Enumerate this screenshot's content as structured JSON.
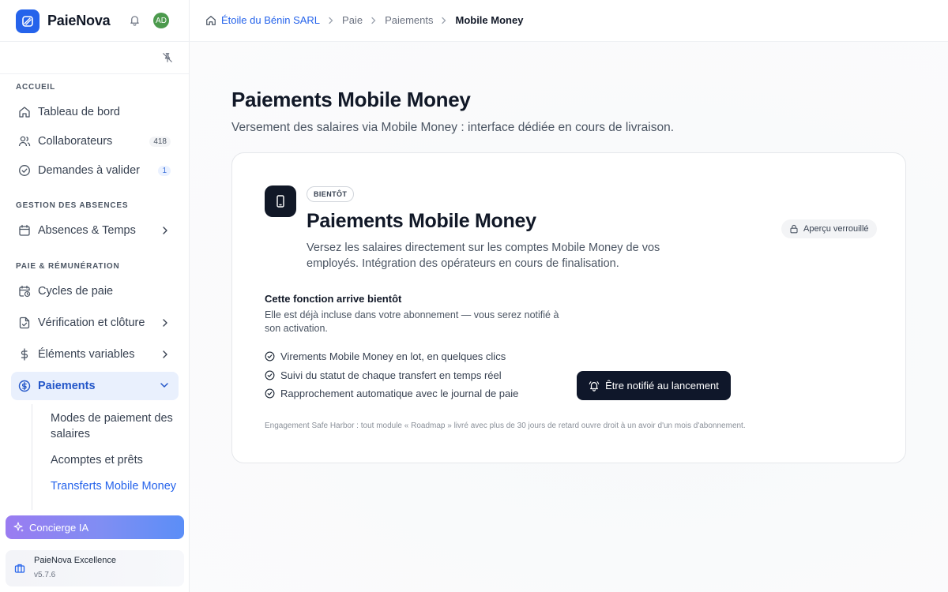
{
  "app": {
    "name": "PaieNova",
    "avatar_initials": "AD",
    "accent": "#2563eb"
  },
  "breadcrumb": [
    "Étoile du Bénin SARL",
    "Paie",
    "Paiements",
    "Mobile Money"
  ],
  "sidebar": {
    "sections": {
      "accueil": "ACCUEIL",
      "absences": "GESTION DES ABSENCES",
      "paie": "PAIE & RÉMUNÉRATION"
    },
    "items": {
      "dashboard": {
        "label": "Tableau de bord",
        "icon": "home-icon"
      },
      "collaborateurs": {
        "label": "Collaborateurs",
        "badge": "418",
        "icon": "users-icon"
      },
      "demandes": {
        "label": "Demandes à valider",
        "badge": "1",
        "icon": "check-circle-icon"
      },
      "absences": {
        "label": "Absences & Temps",
        "icon": "calendar-icon"
      },
      "cycles": {
        "label": "Cycles de paie",
        "icon": "calendar-clock-icon"
      },
      "verification": {
        "label": "Vérification et clôture",
        "icon": "file-check-icon"
      },
      "elements": {
        "label": "Éléments variables",
        "icon": "dollar-icon"
      },
      "paiements": {
        "label": "Paiements",
        "icon": "circle-dollar-icon"
      }
    },
    "sub_items": {
      "modes_line1": "Modes de paiement des",
      "modes_line2": "salaires",
      "acomptes": "Acomptes et prêts",
      "transferts": "Transferts Mobile Money"
    },
    "concierge": "Concierge IA",
    "plan": {
      "name": "PaieNova Excellence",
      "version": "v5.7.6"
    }
  },
  "page": {
    "title": "Paiements Mobile Money",
    "subtitle": "Versement des salaires via Mobile Money : interface dédiée en cours de livraison."
  },
  "card": {
    "badge": "BIENTÔT",
    "title": "Paiements Mobile Money",
    "description": "Versez les salaires directement sur les comptes Mobile Money de vos employés. Intégration des opérateurs en cours de finalisation.",
    "locked_label": "Aperçu verrouillé",
    "coming_title": "Cette fonction arrive bientôt",
    "coming_text": "Elle est déjà incluse dans votre abonnement — vous serez notifié à son activation.",
    "features": [
      "Virements Mobile Money en lot, en quelques clics",
      "Suivi du statut de chaque transfert en temps réel",
      "Rapprochement automatique avec le journal de paie"
    ],
    "notify_button": "Être notifié au lancement",
    "footnote": "Engagement Safe Harbor : tout module « Roadmap » livré avec plus de 30 jours de retard ouvre droit à un avoir d'un mois d'abonnement."
  }
}
